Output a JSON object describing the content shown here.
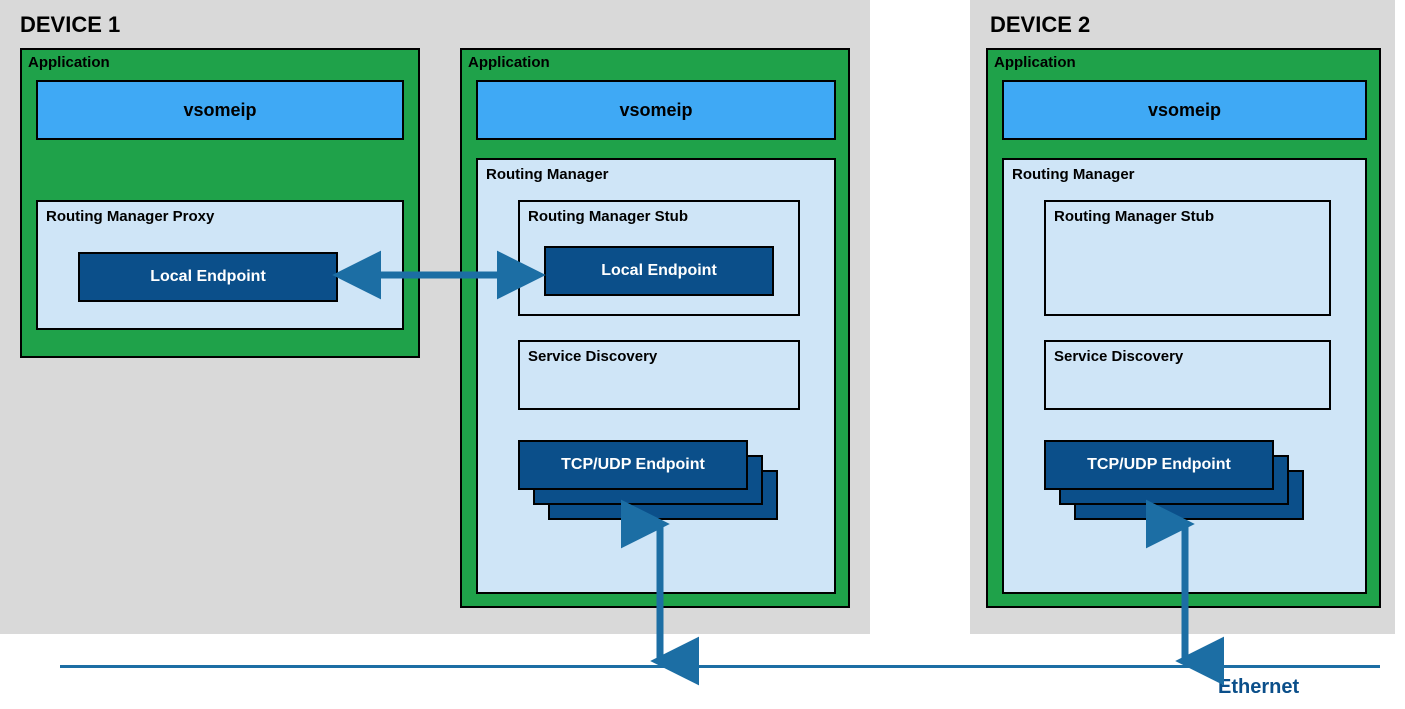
{
  "device1": {
    "label": "DEVICE 1",
    "app1": {
      "label": "Application",
      "vsomeip": "vsomeip",
      "proxy": {
        "label": "Routing Manager Proxy",
        "localEndpoint": "Local Endpoint"
      }
    },
    "app2": {
      "label": "Application",
      "vsomeip": "vsomeip",
      "manager": {
        "label": "Routing Manager",
        "stub": {
          "label": "Routing Manager Stub",
          "localEndpoint": "Local Endpoint"
        },
        "serviceDiscovery": "Service Discovery",
        "tcpUdpEndpoint": "TCP/UDP Endpoint"
      }
    }
  },
  "device2": {
    "label": "DEVICE 2",
    "app": {
      "label": "Application",
      "vsomeip": "vsomeip",
      "manager": {
        "label": "Routing Manager",
        "stub": {
          "label": "Routing Manager Stub"
        },
        "serviceDiscovery": "Service Discovery",
        "tcpUdpEndpoint": "TCP/UDP Endpoint"
      }
    }
  },
  "ethernet": "Ethernet",
  "colors": {
    "green": "#1fa24a",
    "blueLight": "#3fa9f5",
    "paleBlue": "#cfe5f7",
    "darkBlue": "#0b4f8a",
    "arrow": "#1c6ea4",
    "gray": "#d9d9d9"
  }
}
